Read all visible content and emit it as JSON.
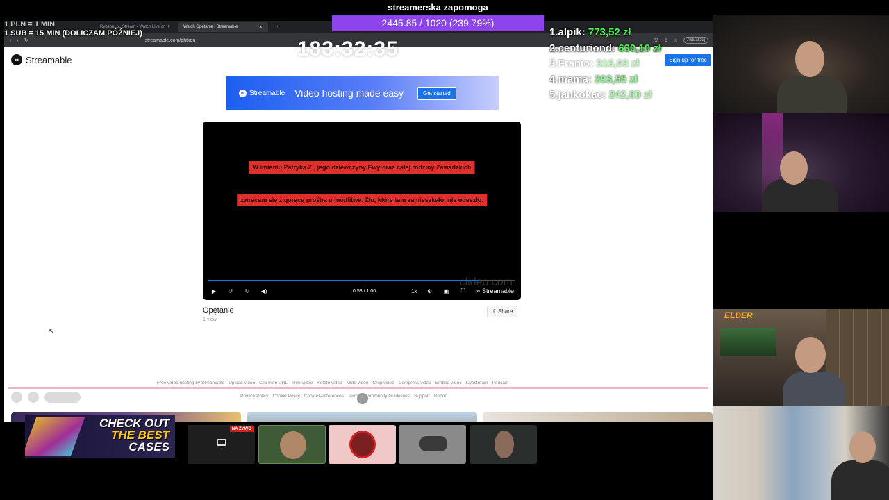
{
  "stream_overlay": {
    "goal_title": "streamerska zapomoga",
    "goal_progress": "2445.85 / 1020 (239.79%)",
    "rate_line1": "1 PLN = 1 MIN",
    "rate_line2": "1 SUB = 15 MIN (DOLICZAM PÓŹNIEJ)",
    "timer": "183:32:35"
  },
  "leaderboard": [
    {
      "rank": "1.",
      "name": "alpik:",
      "amount": "773,52 zł"
    },
    {
      "rank": "2.",
      "name": "centuriond:",
      "amount": "630,10 zł"
    },
    {
      "rank": "3.",
      "name": "Franio:",
      "amount": "316,63 zł"
    },
    {
      "rank": "4.",
      "name": "mama:",
      "amount": "293,55 zł"
    },
    {
      "rank": "5.",
      "name": "jankokac:",
      "amount": "242,80 zł"
    }
  ],
  "browser": {
    "tabs": [
      {
        "label": "RybsonLoL Stream - Watch Live on K"
      },
      {
        "label": "Watch Opętanie | Streamable"
      }
    ],
    "url": "streamable.com/phtkqn",
    "update_label": "Aktualizuj"
  },
  "streamable": {
    "logo": "Streamable",
    "signup": "Sign up for free",
    "banner": {
      "logo": "Streamable",
      "headline": "Video hosting made easy",
      "cta": "Get started"
    },
    "subtitle_line1": "W imieniu Patryka Z., jego dziewczyny Ewy oraz całej rodziny Zawadzkich",
    "subtitle_line2": "zwracam się z gorącą prośbą o modlitwę. Zło, które tam zamieszkało, nie odeszło.",
    "watermark": "clideo.com",
    "time": "0:53 / 1:00",
    "speed": "1x",
    "player_brand": "Streamable",
    "progress_fraction": 0.88,
    "video_title": "Opętanie",
    "views": "1 view",
    "share": "Share",
    "footer_links1": [
      "Free video hosting by Streamable",
      "Upload video",
      "Clip from URL",
      "Trim video",
      "Rotate video",
      "Mute video",
      "Crop video",
      "Compress video",
      "Embed video",
      "Livestream",
      "Podcast"
    ],
    "footer_links2": [
      "Privacy Policy",
      "Cookie Policy",
      "Cookie Preferences",
      "Terms",
      "Community Guidelines",
      "Support",
      "Report"
    ]
  },
  "cams": {
    "elder_label": "ELDER"
  },
  "promo": {
    "line1": "CHECK OUT",
    "line2": "THE BEST",
    "line3": "CASES"
  },
  "tiles": {
    "live_badge": "NA ŻYWO"
  },
  "colors": {
    "goal_bar": "#8e44ec",
    "amount": "#4cf24c",
    "subtitle_bg": "#e0302c",
    "accent": "#1a73e8"
  }
}
